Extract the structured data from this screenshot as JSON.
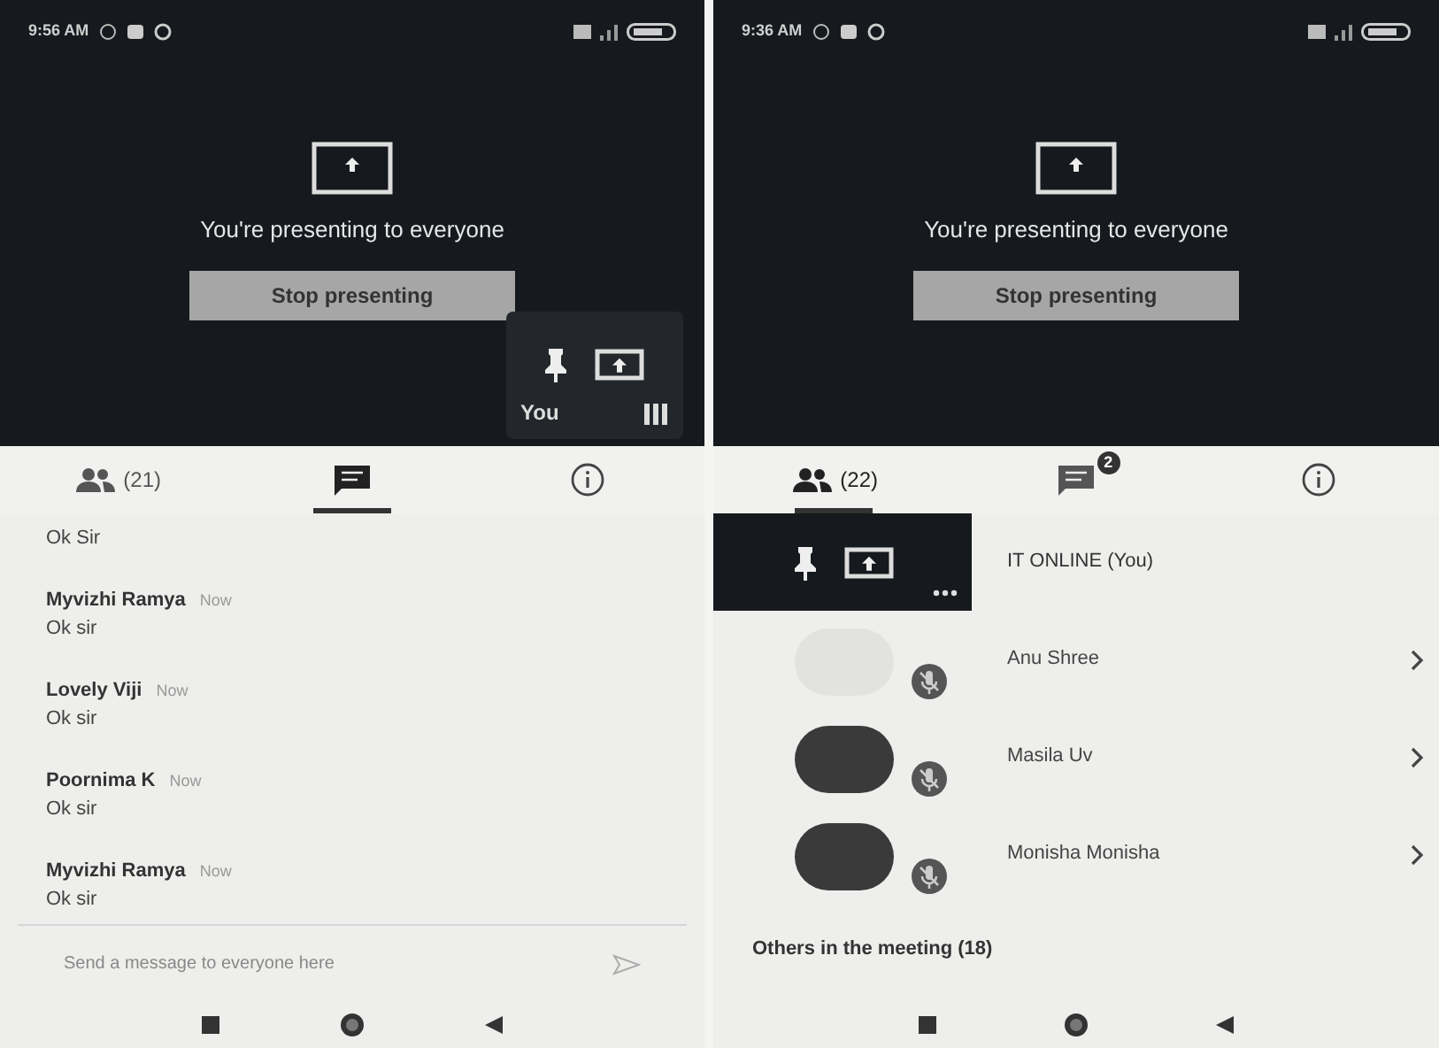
{
  "phones": [
    {
      "status_bar": {
        "time": "9:56 AM"
      },
      "stage": {
        "message": "You're presenting to everyone",
        "button": "Stop presenting",
        "tile": {
          "label": "You"
        }
      },
      "tabs": [
        {
          "kind": "people",
          "label": "(21)",
          "selected": false
        },
        {
          "kind": "chat",
          "selected": true
        },
        {
          "kind": "info",
          "selected": false
        }
      ],
      "chat": {
        "messages": [
          {
            "text": "Ok Sir"
          },
          {
            "sender": "Myvizhi Ramya",
            "time": "Now",
            "text": "Ok sir"
          },
          {
            "sender": "Lovely Viji",
            "time": "Now",
            "text": "Ok sir"
          },
          {
            "sender": "Poornima K",
            "time": "Now",
            "text": "Ok sir"
          },
          {
            "sender": "Myvizhi Ramya",
            "time": "Now",
            "text": "Ok sir"
          }
        ],
        "input": {
          "placeholder": "Send a message to everyone here"
        }
      }
    },
    {
      "status_bar": {
        "time": "9:36 AM"
      },
      "stage": {
        "message": "You're presenting to everyone",
        "button": "Stop presenting"
      },
      "tabs": [
        {
          "kind": "people",
          "label": "(22)",
          "selected": true
        },
        {
          "kind": "chat",
          "badge": "2",
          "selected": false
        },
        {
          "kind": "info",
          "selected": false
        }
      ],
      "participants": {
        "rows": [
          {
            "kind": "self",
            "name": "IT ONLINE (You)"
          },
          {
            "kind": "member",
            "name": "Anu Shree",
            "muted": true
          },
          {
            "kind": "member",
            "name": "Masila Uv",
            "muted": true
          },
          {
            "kind": "member",
            "name": "Monisha Monisha",
            "muted": true
          }
        ],
        "others_heading": "Others in the meeting (18)"
      }
    }
  ]
}
